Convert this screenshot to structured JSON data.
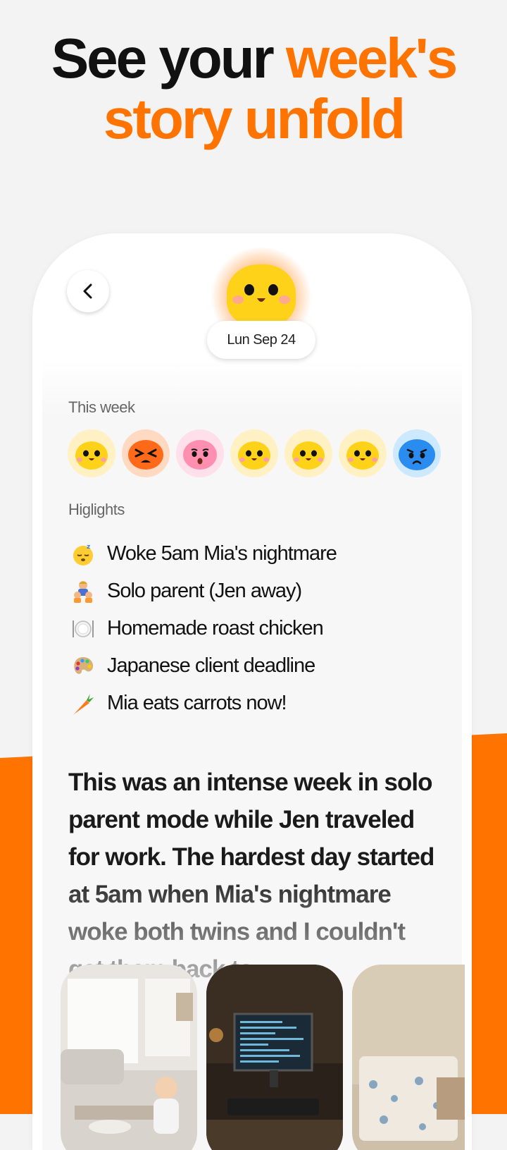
{
  "headline": {
    "line1_plain": "See your ",
    "line1_accent": "week's",
    "line2_accent": "story unfold"
  },
  "colors": {
    "accent": "#ff7300",
    "mood_yellow": "#ffd21a",
    "mood_orange": "#ff6a1a",
    "mood_pink": "#ff8fb0",
    "mood_blue": "#2b8cf0"
  },
  "header": {
    "back_icon": "chevron-left-icon",
    "mood_icon": "happy-blob-icon",
    "date": "Lun Sep 24"
  },
  "week": {
    "label": "This week",
    "days": [
      {
        "mood": "happy",
        "color": "yellow"
      },
      {
        "mood": "angry",
        "color": "orange"
      },
      {
        "mood": "surprised",
        "color": "pink"
      },
      {
        "mood": "happy",
        "color": "yellow"
      },
      {
        "mood": "happy",
        "color": "yellow"
      },
      {
        "mood": "happy",
        "color": "yellow"
      },
      {
        "mood": "sad",
        "color": "blue"
      }
    ]
  },
  "highlights": {
    "label": "Higlights",
    "items": [
      {
        "icon": "sleeping-face-icon",
        "text": "Woke 5am Mia's nightmare"
      },
      {
        "icon": "family-icon",
        "text": "Solo parent (Jen away)"
      },
      {
        "icon": "plate-icon",
        "text": "Homemade roast chicken"
      },
      {
        "icon": "palette-icon",
        "text": "Japanese client deadline"
      },
      {
        "icon": "carrot-icon",
        "text": "Mia eats carrots now!"
      }
    ]
  },
  "story": {
    "text": "This was an intense week in solo parent mode while Jen traveled for work. The hardest day started at 5am when Mia's nightmare woke both twins and I couldn't get them back to"
  },
  "photos": [
    {
      "subject": "living-room-photo"
    },
    {
      "subject": "computer-desk-photo"
    },
    {
      "subject": "kids-bedroom-photo"
    }
  ]
}
